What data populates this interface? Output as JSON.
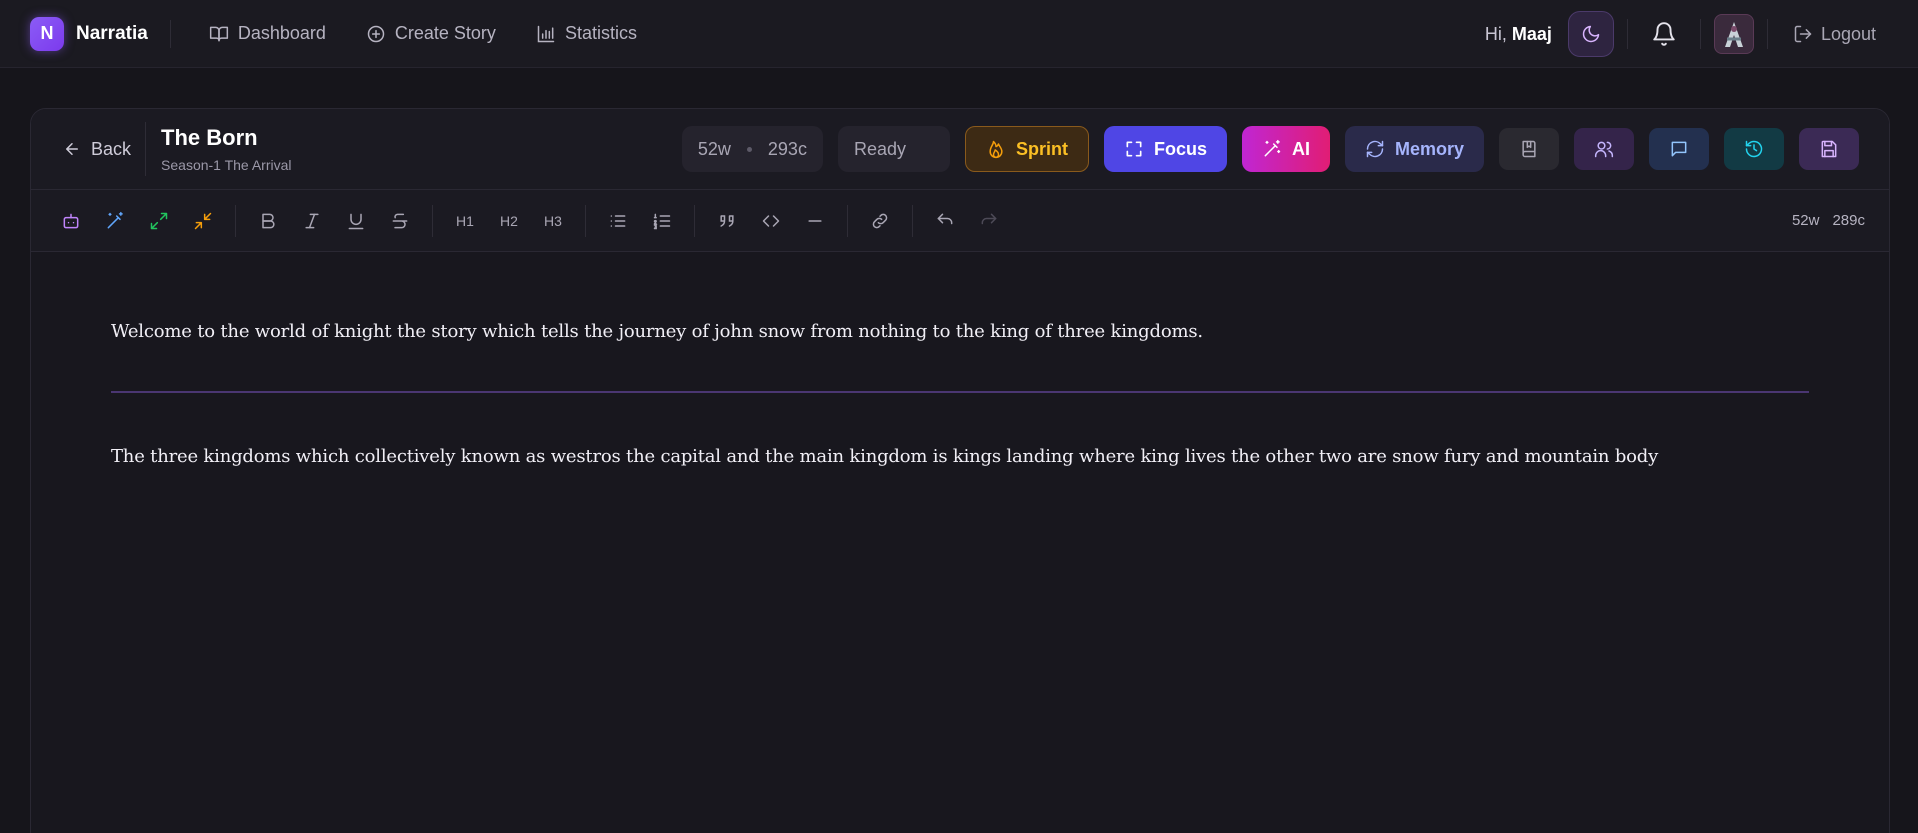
{
  "app": {
    "name": "Narratia",
    "logo_letter": "N"
  },
  "nav": {
    "links": [
      {
        "label": "Dashboard",
        "icon": "book-open-icon"
      },
      {
        "label": "Create Story",
        "icon": "plus-circle-icon"
      },
      {
        "label": "Statistics",
        "icon": "bar-chart-icon"
      }
    ],
    "greeting_prefix": "Hi, ",
    "user_name": "Maaj",
    "logout_label": "Logout"
  },
  "editor": {
    "back_label": "Back",
    "title": "The Born",
    "subtitle": "Season-1 The Arrival",
    "words_header": "52w",
    "chars_header": "293c",
    "status": "Ready",
    "buttons": {
      "sprint": "Sprint",
      "focus": "Focus",
      "ai": "AI",
      "memory": "Memory"
    },
    "toolbar": {
      "h1": "H1",
      "h2": "H2",
      "h3": "H3",
      "words": "52w",
      "chars": "289c"
    },
    "paragraphs": [
      "Welcome to the world of knight the story which tells the journey of john snow from nothing to the king of three kingdoms.",
      "The three kingdoms which collectively known as westros the capital and the main kingdom is kings landing where king lives the other two are snow fury and mountain body"
    ]
  },
  "colors": {
    "accent": "#8b5cf6",
    "sprint": "#fbbf24",
    "focus": "#4f46e5",
    "ai": "#c026d3",
    "memory": "#a5b4fc"
  }
}
